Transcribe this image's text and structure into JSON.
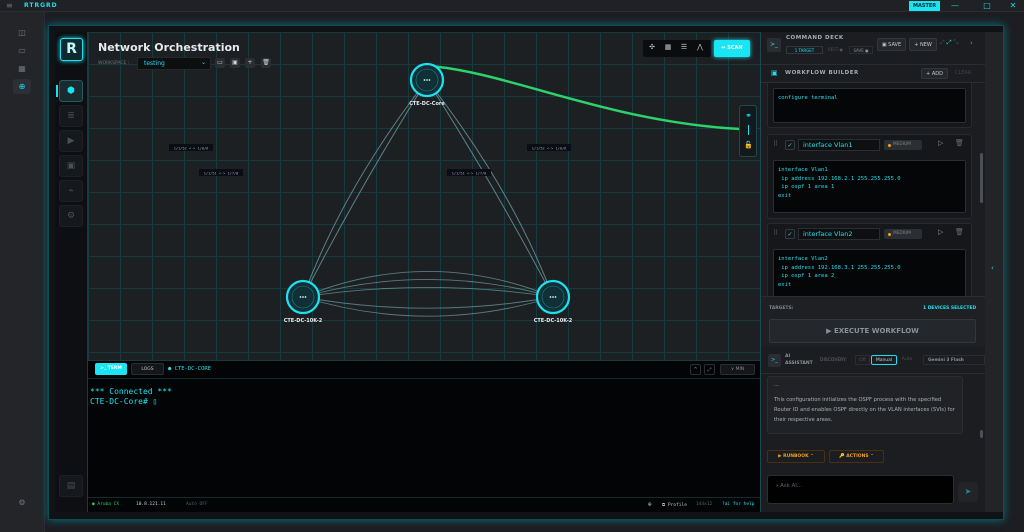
{
  "app": {
    "brand": "RTRGRD",
    "mode_badge": "MASTER",
    "window_controls": [
      "—",
      "□",
      "✕"
    ]
  },
  "app_rail": {
    "items": [
      {
        "icon": "sidebar-icon",
        "glyph": "◫"
      },
      {
        "icon": "monitor-icon",
        "glyph": "▭"
      },
      {
        "icon": "grid-icon",
        "glyph": "▦"
      },
      {
        "icon": "globe-icon",
        "glyph": "⊕",
        "active": true
      }
    ],
    "settings_glyph": "⚙"
  },
  "tool_rail": {
    "logo_letter": "R",
    "items": [
      {
        "icon": "network-hex-icon",
        "glyph": "⬢",
        "active": true
      },
      {
        "icon": "database-icon",
        "glyph": "≣"
      },
      {
        "icon": "file-play-icon",
        "glyph": "▶"
      },
      {
        "icon": "chip-icon",
        "glyph": "▣"
      },
      {
        "icon": "waveform-monitor-icon",
        "glyph": "⌁"
      },
      {
        "icon": "users-gear-icon",
        "glyph": "⚙"
      }
    ],
    "bottom_glyph": "▤"
  },
  "canvas": {
    "title": "Network Orchestration",
    "workspace_label": "WORKSPACE :",
    "workspace_value": "testing",
    "workspace_buttons": [
      "folder-icon",
      "save-file-icon",
      "plus-icon",
      "trash-icon"
    ],
    "view_tools": [
      "✣",
      "▦",
      "☰",
      "⋀"
    ],
    "scan_label": "⇔ SCAN",
    "nodes": [
      {
        "id": "core",
        "label": "CTE-DC-Core"
      },
      {
        "id": "left",
        "label": "CTE-DC-10K-2"
      },
      {
        "id": "right",
        "label": "CTE-DC-10K-2"
      }
    ],
    "links": [
      {
        "from": "core",
        "to": "left",
        "label": "1/1/52 <-> 1/0/6"
      },
      {
        "from": "core",
        "to": "left",
        "label": "1/1/51 <-> 1/7/8"
      },
      {
        "from": "core",
        "to": "right",
        "label": "1/1/52 <-> 1/0/6"
      },
      {
        "from": "core",
        "to": "right",
        "label": "1/1/51 <-> 1/7/8"
      }
    ],
    "link_color": "#8fd3d8",
    "uplink_color": "#2bd36b",
    "node_color": "#1ee0f0"
  },
  "terminal": {
    "term_tab": ">_ TERM",
    "logs_tab": "LOGS",
    "device": "● CTE-DC-CORE",
    "min_label": "∨ MIN",
    "lines": [
      "*** Connected ***",
      "CTE-DC-Core# ▯"
    ],
    "status": {
      "device": "● Aruba CX",
      "ip": "10.8.121.11",
      "auto": "Auto OFF",
      "profile": "Profile",
      "size": "144x12",
      "help": "?ai for help"
    }
  },
  "command_deck": {
    "title": "COMMAND DECK",
    "chips": [
      "1 TARGET",
      "REST ●",
      "SAVE ●"
    ],
    "save": "▣ SAVE",
    "new": "+ NEW",
    "workflow_title": "WORKFLOW BUILDER",
    "add": "+ ADD",
    "clear": "CLEAR",
    "first_block_code": "configure terminal",
    "blocks": [
      {
        "name": "interface Vlan1",
        "priority": "MEDIUM",
        "code": "interface Vlan1\n ip address 192.168.2.1 255.255.255.0\n ip ospf 1 area 1\nexit"
      },
      {
        "name": "interface Vlan2",
        "priority": "MEDIUM",
        "code": "interface Vlan2\n ip address 192.168.3.1 255.255.255.0\n ip ospf 1 area 2\nexit"
      }
    ],
    "targets_label": "TARGETS:",
    "targets_value": "1 DEVICES SELECTED",
    "execute": "▶ EXECUTE WORKFLOW"
  },
  "ai": {
    "title_line1": "AI",
    "title_line2": "ASSISTANT",
    "discovery_label": "DISCOVERY:",
    "modes": [
      "Off",
      "Manual",
      "Auto"
    ],
    "active_mode": "Manual",
    "model": "Gemini 3 Flash",
    "message_prefix": "...",
    "message": "This configuration initializes the OSPF process with the specified Router ID and enables OSPF directly on the VLAN interfaces (SVIs) for their respective areas.",
    "runbook": "▶ RUNBOOK ⌃",
    "actions": "🔑 ACTIONS ⌃",
    "input_placeholder": "Ask AI..."
  }
}
